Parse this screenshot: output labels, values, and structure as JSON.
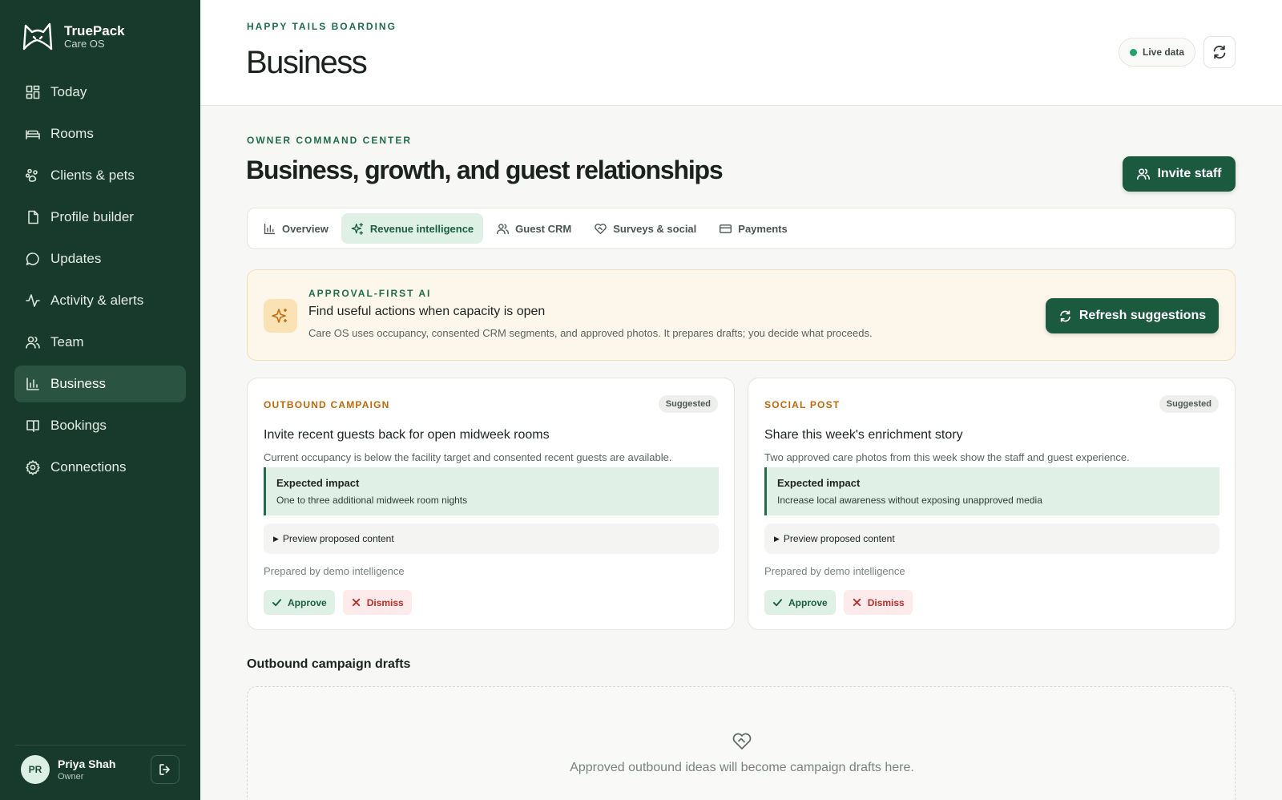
{
  "brand": {
    "name": "TruePack",
    "sub": "Care OS"
  },
  "sidebar": {
    "items": [
      {
        "label": "Today",
        "icon": "dashboard-icon",
        "active": false
      },
      {
        "label": "Rooms",
        "icon": "bed-icon",
        "active": false
      },
      {
        "label": "Clients & pets",
        "icon": "paw-icon",
        "active": false
      },
      {
        "label": "Profile builder",
        "icon": "document-icon",
        "active": false
      },
      {
        "label": "Updates",
        "icon": "chat-bubble-icon",
        "active": false
      },
      {
        "label": "Activity & alerts",
        "icon": "activity-icon",
        "active": false
      },
      {
        "label": "Team",
        "icon": "users-icon",
        "active": false
      },
      {
        "label": "Business",
        "icon": "bar-chart-icon",
        "active": true
      },
      {
        "label": "Bookings",
        "icon": "book-icon",
        "active": false
      },
      {
        "label": "Connections",
        "icon": "gear-icon",
        "active": false
      }
    ]
  },
  "user": {
    "initials": "PR",
    "name": "Priya Shah",
    "role": "Owner"
  },
  "header": {
    "org": "HAPPY TAILS BOARDING",
    "title": "Business",
    "live_label": "Live data"
  },
  "section": {
    "eyebrow": "OWNER COMMAND CENTER",
    "title": "Business, growth, and guest relationships",
    "invite_label": "Invite staff"
  },
  "tabs": [
    {
      "label": "Overview",
      "icon": "bar-chart-icon",
      "active": false
    },
    {
      "label": "Revenue intelligence",
      "icon": "sparkle-icon",
      "active": true
    },
    {
      "label": "Guest CRM",
      "icon": "users-icon",
      "active": false
    },
    {
      "label": "Surveys & social",
      "icon": "heart-handshake-icon",
      "active": false
    },
    {
      "label": "Payments",
      "icon": "credit-card-icon",
      "active": false
    }
  ],
  "ai_banner": {
    "eyebrow": "APPROVAL-FIRST AI",
    "title": "Find useful actions when capacity is open",
    "description": "Care OS uses occupancy, consented CRM segments, and approved photos. It prepares drafts; you decide what proceeds.",
    "button_label": "Refresh suggestions"
  },
  "cards": [
    {
      "type": "OUTBOUND CAMPAIGN",
      "badge": "Suggested",
      "title": "Invite recent guests back for open midweek rooms",
      "description": "Current occupancy is below the facility target and consented recent guests are available.",
      "impact_label": "Expected impact",
      "impact_text": "One to three additional midweek room nights",
      "preview_label": "Preview proposed content",
      "prepared_by": "Prepared by demo intelligence",
      "approve_label": "Approve",
      "dismiss_label": "Dismiss"
    },
    {
      "type": "SOCIAL POST",
      "badge": "Suggested",
      "title": "Share this week's enrichment story",
      "description": "Two approved care photos from this week show the staff and guest experience.",
      "impact_label": "Expected impact",
      "impact_text": "Increase local awareness without exposing unapproved media",
      "preview_label": "Preview proposed content",
      "prepared_by": "Prepared by demo intelligence",
      "approve_label": "Approve",
      "dismiss_label": "Dismiss"
    }
  ],
  "drafts": {
    "title": "Outbound campaign drafts",
    "empty_text": "Approved outbound ideas will become campaign drafts here."
  },
  "colors": {
    "sidebar_bg": "#183a2c",
    "accent": "#1c5a40",
    "live_dot": "#1fa36a",
    "card_type": "#b86a0f",
    "dismiss": "#b3302b"
  }
}
